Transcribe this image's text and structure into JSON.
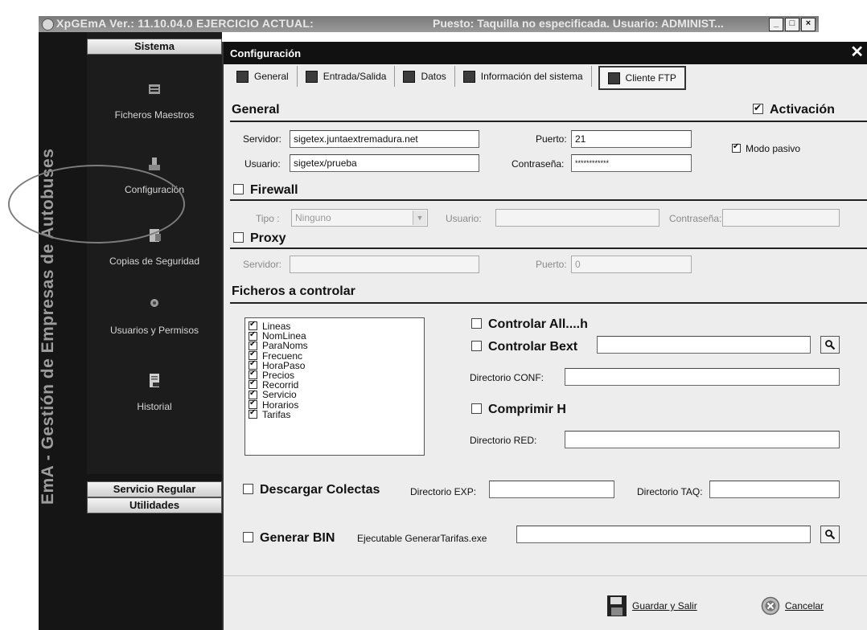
{
  "app": {
    "title": "XpGEmA Ver.: 11.10.04.0 EJERCICIO ACTUAL:",
    "puesto": "Puesto: Taquilla no especificada. Usuario: ADMINIST...",
    "vertical_title": "EmA - Gestión de Empresas de Autobuses"
  },
  "sidebar": {
    "header": "Sistema",
    "items": [
      {
        "label": "Ficheros Maestros",
        "icon": "folders-icon"
      },
      {
        "label": "Configuración",
        "icon": "config-icon"
      },
      {
        "label": "Copias de Seguridad",
        "icon": "backup-icon"
      },
      {
        "label": "Usuarios y Permisos",
        "icon": "users-icon"
      },
      {
        "label": "Historial",
        "icon": "history-icon"
      }
    ],
    "bottom_headers": [
      "Servicio Regular",
      "Utilidades"
    ]
  },
  "dialog": {
    "title": "Configuración",
    "tabs": [
      "General",
      "Entrada/Salida",
      "Datos",
      "Información del sistema",
      "Cliente FTP"
    ],
    "general": {
      "title": "General",
      "activacion": "Activación",
      "servidor_label": "Servidor:",
      "servidor_value": "sigetex.juntaextremadura.net",
      "puerto_label": "Puerto:",
      "puerto_value": "21",
      "usuario_label": "Usuario:",
      "usuario_value": "sigetex/prueba",
      "contrasena_label": "Contraseña:",
      "contrasena_value": "************",
      "modo_pasivo": "Modo pasivo"
    },
    "firewall": {
      "title": "Firewall",
      "tipo_label": "Tipo :",
      "tipo_value": "Ninguno",
      "usuario_label": "Usuario:",
      "contrasena_label": "Contraseña:"
    },
    "proxy": {
      "title": "Proxy",
      "servidor_label": "Servidor:",
      "puerto_label": "Puerto:",
      "puerto_value": "0"
    },
    "ficheros": {
      "title": "Ficheros a controlar",
      "files": [
        "Lineas",
        "NomLinea",
        "ParaNoms",
        "Frecuenc",
        "HoraPaso",
        "Precios",
        "Recorrid",
        "Servicio",
        "Horarios",
        "Tarifas"
      ],
      "controlar_all": "Controlar All....h",
      "controlar_bext": "Controlar Bext",
      "directorio_conf": "Directorio CONF:",
      "comprimir_h": "Comprimir H",
      "directorio_red": "Directorio RED:"
    },
    "descargar": {
      "label": "Descargar Colectas",
      "directorio_exp": "Directorio EXP:",
      "directorio_taq": "Directorio TAQ:"
    },
    "generar": {
      "label": "Generar BIN",
      "ejecutable": "Ejecutable GenerarTarifas.exe"
    },
    "buttons": {
      "guardar": "Guardar y Salir",
      "cancelar": "Cancelar"
    }
  }
}
